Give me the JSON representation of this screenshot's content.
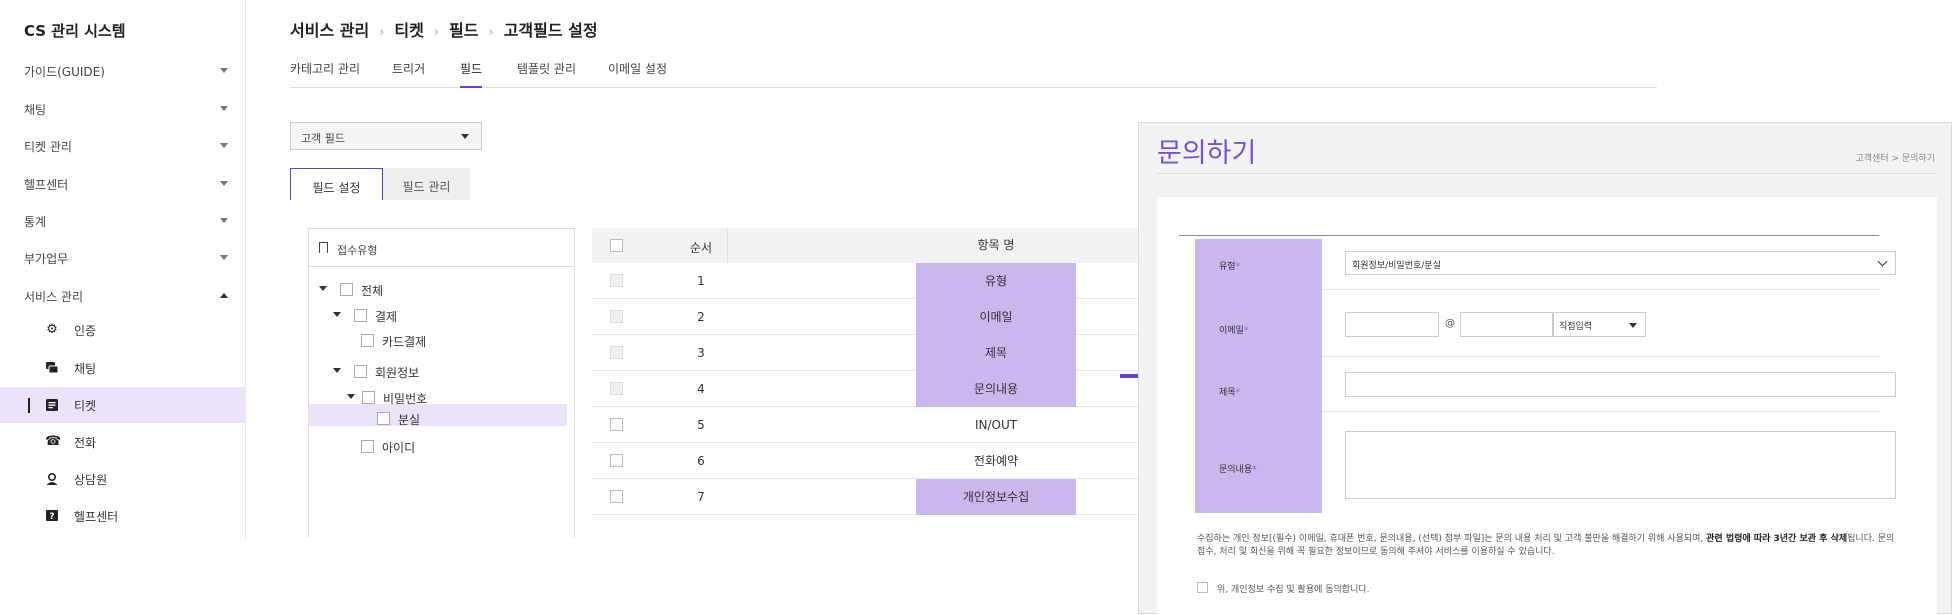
{
  "app": {
    "title": "CS 관리 시스템"
  },
  "sidebar": {
    "items": [
      {
        "label": "가이드(GUIDE)"
      },
      {
        "label": "채팅"
      },
      {
        "label": "티켓 관리"
      },
      {
        "label": "헬프센터"
      },
      {
        "label": "통계"
      },
      {
        "label": "부가업무"
      },
      {
        "label": "서비스 관리"
      }
    ],
    "sub_items": [
      {
        "label": "인증",
        "icon": "gear-icon"
      },
      {
        "label": "채팅",
        "icon": "chat-icon"
      },
      {
        "label": "티켓",
        "icon": "ticket-icon"
      },
      {
        "label": "전화",
        "icon": "phone-icon"
      },
      {
        "label": "상담원",
        "icon": "agent-icon"
      },
      {
        "label": "헬프센터",
        "icon": "help-icon"
      }
    ]
  },
  "breadcrumb": [
    "서비스 관리",
    "티켓",
    "필드",
    "고객필드 설정"
  ],
  "tabs": [
    "카테고리 관리",
    "트리거",
    "필드",
    "템플릿 관리",
    "이메일 설정"
  ],
  "field_type_select": {
    "value": "고객 필드"
  },
  "field_tabs": [
    "필드 설정",
    "필드 관리"
  ],
  "tree": {
    "header": "접수유형",
    "nodes": [
      "전체",
      "결제",
      "카드결제",
      "회원정보",
      "비밀번호",
      "분실",
      "아이디"
    ]
  },
  "grid": {
    "headers": {
      "order": "순서",
      "name": "항목 명"
    },
    "rows": [
      {
        "order": "1",
        "name": "유형",
        "highlight": true,
        "disabled": true
      },
      {
        "order": "2",
        "name": "이메일",
        "highlight": true,
        "disabled": true
      },
      {
        "order": "3",
        "name": "제목",
        "highlight": true,
        "disabled": true
      },
      {
        "order": "4",
        "name": "문의내용",
        "highlight": true,
        "disabled": true
      },
      {
        "order": "5",
        "name": "IN/OUT",
        "highlight": false,
        "disabled": false
      },
      {
        "order": "6",
        "name": "전화예약",
        "highlight": false,
        "disabled": false
      },
      {
        "order": "7",
        "name": "개인정보수집",
        "highlight": true,
        "disabled": false
      }
    ]
  },
  "preview": {
    "title": "문의하기",
    "crumb": "고객센터 > 문의하기",
    "labels": {
      "type": "유형",
      "email": "이메일",
      "subject": "제목",
      "content": "문의내용",
      "required_mark": "*"
    },
    "type_value": "회원정보/비밀번호/분실",
    "email_at": "@",
    "email_domain_select": "직접입력",
    "privacy_text_1": "수집하는 개인 정보[(필수) 이메일, 휴대폰 번호, 문의내용, (선택) 첨부 파일]는 문의 내용 처리 및 고객 불만을 해결하기 위해 사용되며, ",
    "privacy_text_bold": "관련 법령에 따라 3년간 보관 후 삭제",
    "privacy_text_2": "됩니다. 문의 접수, 처리 및 회신을 위해 꼭 필요한 정보이므로 동의해 주셔야 서비스를 이용하실 수 있습니다.",
    "agree_label": "위, 개인정보 수집 및 활용에 동의합니다."
  },
  "colors": {
    "accent": "#6d3fd0",
    "highlight": "#c9b7ee",
    "active_bg": "#ece3fb",
    "preview_title": "#7a4fd8"
  }
}
